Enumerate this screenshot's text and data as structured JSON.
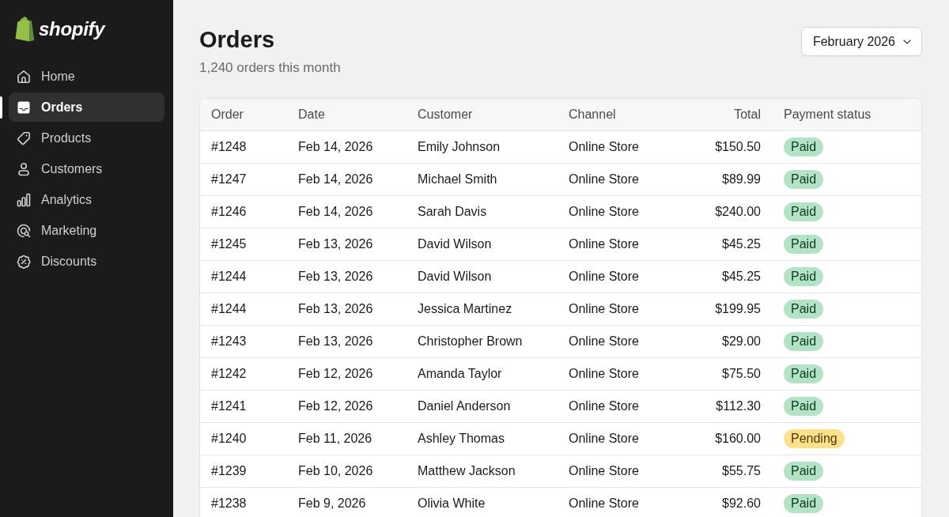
{
  "sidebar": {
    "brand": "shopify",
    "items": [
      {
        "label": "Home",
        "selected": false
      },
      {
        "label": "Orders",
        "selected": true
      },
      {
        "label": "Products",
        "selected": false
      },
      {
        "label": "Customers",
        "selected": false
      },
      {
        "label": "Analytics",
        "selected": false
      },
      {
        "label": "Marketing",
        "selected": false
      },
      {
        "label": "Discounts",
        "selected": false
      }
    ]
  },
  "header": {
    "title": "Orders",
    "subtitle": "1,240 orders this month",
    "period_select": {
      "value": "February 2026"
    }
  },
  "table": {
    "columns": [
      "Order",
      "Date",
      "Customer",
      "Channel",
      "Total",
      "Payment status"
    ],
    "rows": [
      {
        "order": "#1248",
        "date": "Feb 14, 2026",
        "customer": "Emily Johnson",
        "channel": "Online Store",
        "total": "$150.50",
        "status": {
          "label": "Paid",
          "kind": "success"
        }
      },
      {
        "order": "#1247",
        "date": "Feb 14, 2026",
        "customer": "Michael Smith",
        "channel": "Online Store",
        "total": "$89.99",
        "status": {
          "label": "Paid",
          "kind": "success"
        }
      },
      {
        "order": "#1246",
        "date": "Feb 14, 2026",
        "customer": "Sarah Davis",
        "channel": "Online Store",
        "total": "$240.00",
        "status": {
          "label": "Paid",
          "kind": "success"
        }
      },
      {
        "order": "#1245",
        "date": "Feb 13, 2026",
        "customer": "David Wilson",
        "channel": "Online Store",
        "total": "$45.25",
        "status": {
          "label": "Paid",
          "kind": "success"
        }
      },
      {
        "order": "#1244",
        "date": "Feb 13, 2026",
        "customer": "David Wilson",
        "channel": "Online Store",
        "total": "$45.25",
        "status": {
          "label": "Paid",
          "kind": "success"
        }
      },
      {
        "order": "#1244",
        "date": "Feb 13, 2026",
        "customer": "Jessica Martinez",
        "channel": "Online Store",
        "total": "$199.95",
        "status": {
          "label": "Paid",
          "kind": "success"
        }
      },
      {
        "order": "#1243",
        "date": "Feb 13, 2026",
        "customer": "Christopher Brown",
        "channel": "Online Store",
        "total": "$29.00",
        "status": {
          "label": "Paid",
          "kind": "success"
        }
      },
      {
        "order": "#1242",
        "date": "Feb 12, 2026",
        "customer": "Amanda Taylor",
        "channel": "Online Store",
        "total": "$75.50",
        "status": {
          "label": "Paid",
          "kind": "success"
        }
      },
      {
        "order": "#1241",
        "date": "Feb 12, 2026",
        "customer": "Daniel Anderson",
        "channel": "Online Store",
        "total": "$112.30",
        "status": {
          "label": "Paid",
          "kind": "success"
        }
      },
      {
        "order": "#1240",
        "date": "Feb 11, 2026",
        "customer": "Ashley Thomas",
        "channel": "Online Store",
        "total": "$160.00",
        "status": {
          "label": "Pending",
          "kind": "warning"
        }
      },
      {
        "order": "#1239",
        "date": "Feb 10, 2026",
        "customer": "Matthew Jackson",
        "channel": "Online Store",
        "total": "$55.75",
        "status": {
          "label": "Paid",
          "kind": "success"
        }
      },
      {
        "order": "#1238",
        "date": "Feb 9, 2026",
        "customer": "Olivia White",
        "channel": "Online Store",
        "total": "$92.60",
        "status": {
          "label": "Paid",
          "kind": "success"
        }
      }
    ]
  }
}
